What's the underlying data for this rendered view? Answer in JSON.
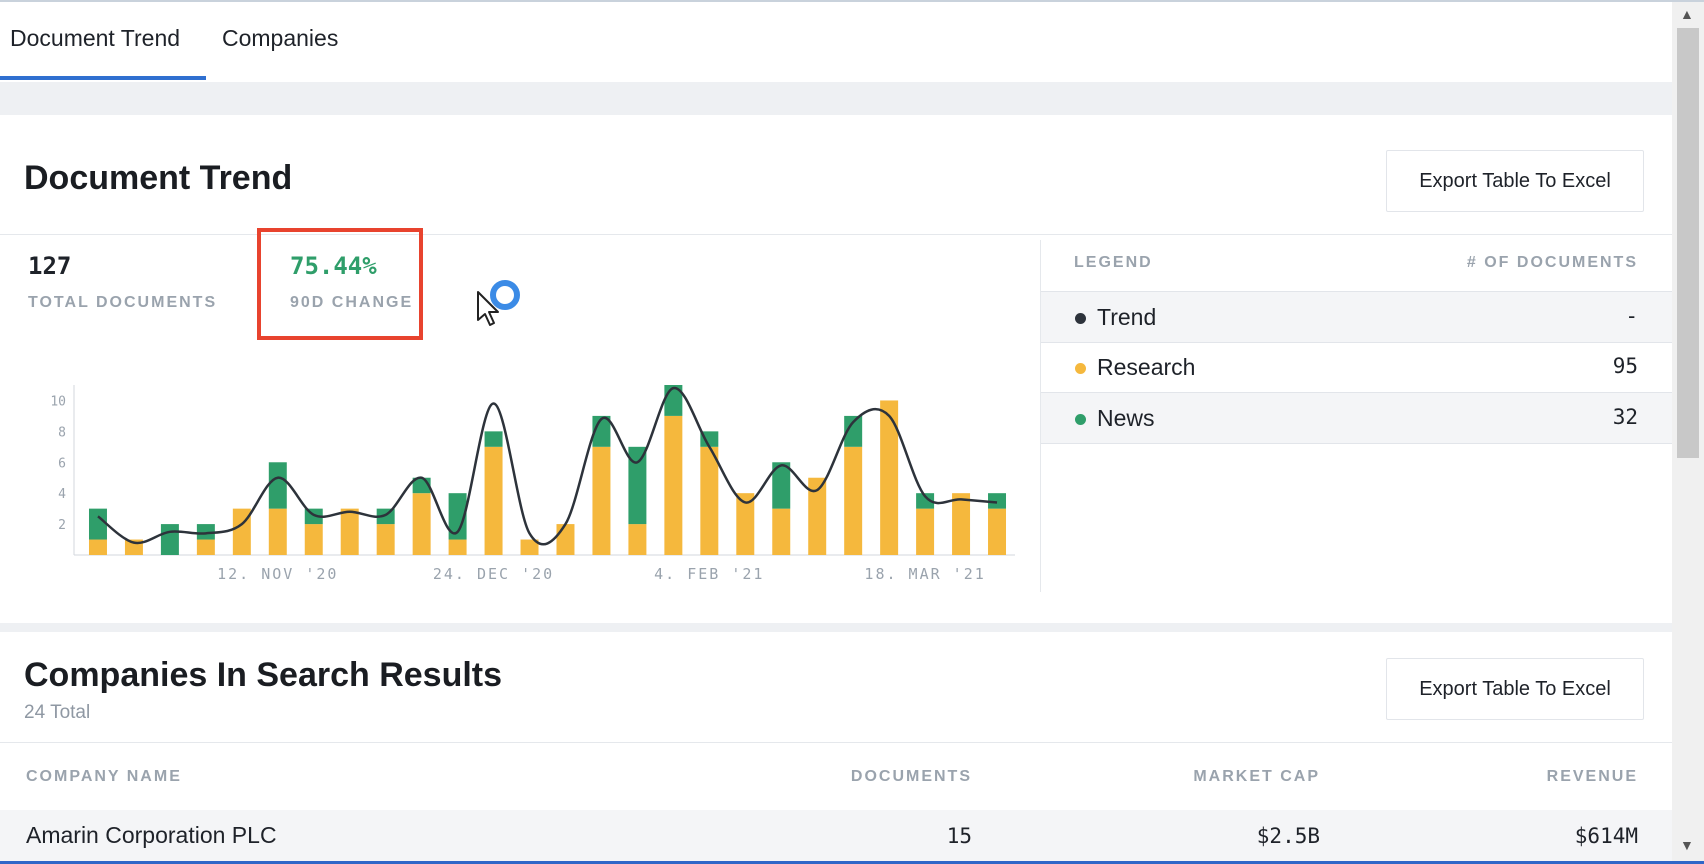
{
  "tabs": [
    {
      "label": "Document Trend",
      "active": true
    },
    {
      "label": "Companies",
      "active": false
    }
  ],
  "trend_card": {
    "title": "Document Trend",
    "export_label": "Export Table To Excel",
    "stats": {
      "total_value": "127",
      "total_label": "TOTAL DOCUMENTS",
      "change_value": "75.44%",
      "change_label": "90D CHANGE"
    },
    "legend": {
      "header_left": "LEGEND",
      "header_right": "# OF DOCUMENTS",
      "items": [
        {
          "name": "Trend",
          "count": "-",
          "color": "#2d333b"
        },
        {
          "name": "Research",
          "count": "95",
          "color": "#f5b83d"
        },
        {
          "name": "News",
          "count": "32",
          "color": "#2f9e6a"
        }
      ]
    }
  },
  "chart_data": {
    "type": "bar",
    "stacked": true,
    "ylim": [
      0,
      11
    ],
    "y_ticks": [
      2,
      4,
      6,
      8,
      10
    ],
    "x_tick_labels": [
      "12. NOV '20",
      "24. DEC '20",
      "4. FEB '21",
      "18. MAR '21"
    ],
    "x_tick_positions": [
      5.5,
      11.5,
      17.5,
      23.5
    ],
    "categories": 26,
    "series": [
      {
        "name": "Research",
        "color": "#f5b83d",
        "values": [
          1,
          1,
          0,
          1,
          3,
          3,
          2,
          3,
          2,
          4,
          1,
          7,
          1,
          2,
          7,
          2,
          9,
          7,
          4,
          3,
          5,
          7,
          10,
          3,
          4,
          3
        ]
      },
      {
        "name": "News",
        "color": "#2f9e6a",
        "values": [
          2,
          0,
          2,
          1,
          0,
          3,
          1,
          0,
          1,
          1,
          3,
          1,
          0,
          0,
          2,
          5,
          2,
          1,
          0,
          3,
          0,
          2,
          0,
          1,
          0,
          1
        ]
      },
      {
        "name": "Trend",
        "color": "#2d333b",
        "type": "line",
        "values": [
          2.5,
          0.8,
          1.5,
          1.4,
          2,
          5,
          2.6,
          2.8,
          2.6,
          5,
          1.5,
          9.8,
          1.4,
          2,
          8.8,
          6,
          10.8,
          7,
          3.4,
          5.8,
          4.2,
          8.6,
          9,
          3.8,
          3.6,
          3.4
        ]
      }
    ]
  },
  "companies_card": {
    "title": "Companies In Search Results",
    "subtitle": "24 Total",
    "export_label": "Export Table To Excel",
    "columns": [
      "COMPANY NAME",
      "DOCUMENTS",
      "MARKET CAP",
      "REVENUE"
    ],
    "rows": [
      {
        "name": "Amarin Corporation PLC",
        "documents": "15",
        "market_cap": "$2.5B",
        "revenue": "$614M"
      }
    ]
  },
  "scrollbar": {
    "up": "▲",
    "down": "▼"
  }
}
